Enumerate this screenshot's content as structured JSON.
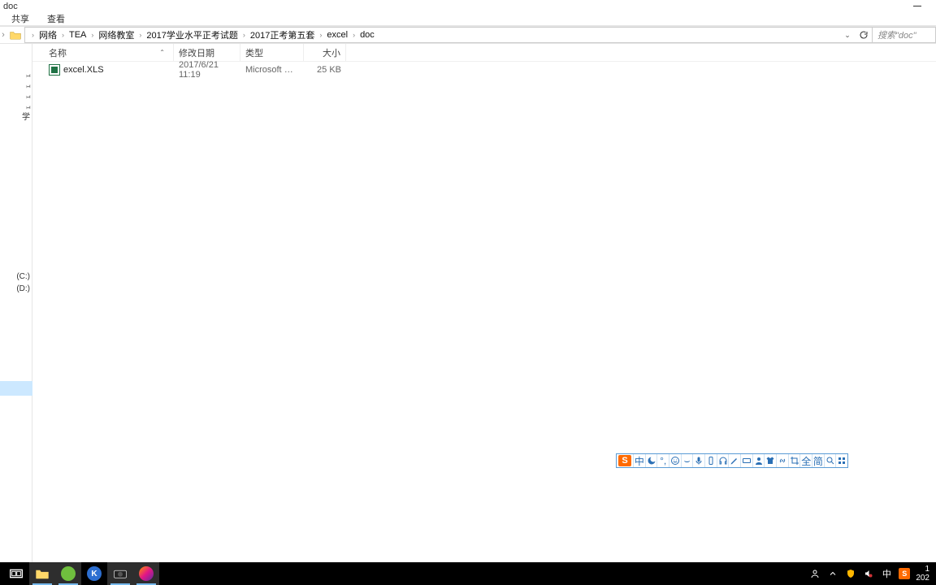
{
  "window": {
    "title": "doc"
  },
  "ribbon": {
    "share": "共享",
    "view": "查看"
  },
  "breadcrumb": {
    "segments": [
      "网络",
      "TEA",
      "网络教室",
      "2017学业水平正考试题",
      "2017正考第五套",
      "excel",
      "doc"
    ]
  },
  "search": {
    "placeholder": "搜索\"doc\""
  },
  "columns": {
    "name": "名称",
    "date": "修改日期",
    "type": "类型",
    "size": "大小"
  },
  "files": [
    {
      "name": "excel.XLS",
      "date": "2017/6/21 11:19",
      "type": "Microsoft Excel ...",
      "size": "25 KB"
    }
  ],
  "sidebar": {
    "group_char": "学",
    "drive_c": "(C:)",
    "drive_d": "(D:)"
  },
  "ime": {
    "logo": "S",
    "items": [
      "中",
      "moon",
      "punct",
      "smile",
      "comma",
      "mic",
      "phone",
      "pen",
      "key",
      "keyboard",
      "person",
      "shirt",
      "link",
      "crop",
      "全",
      "简",
      "search",
      "grid"
    ]
  },
  "tray": {
    "zh": "中",
    "clock_top": "1",
    "clock_bottom": "202"
  }
}
